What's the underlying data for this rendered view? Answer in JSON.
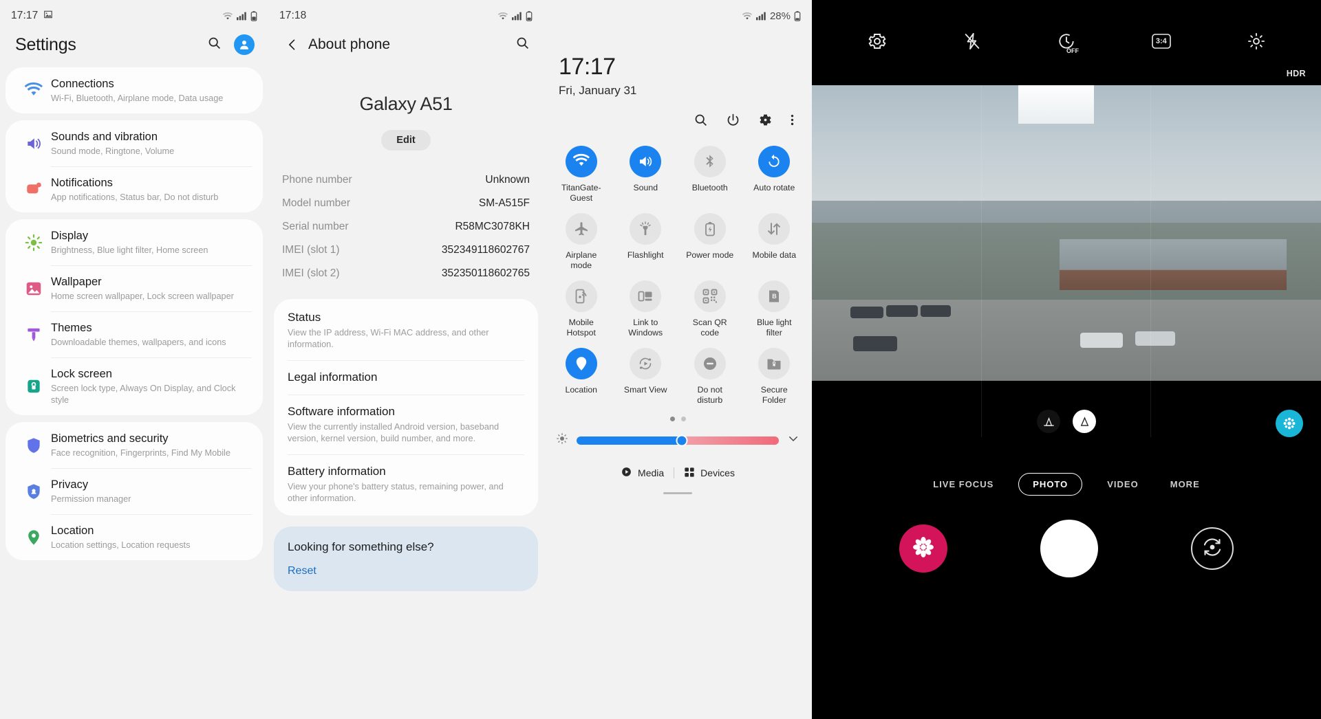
{
  "panel_settings": {
    "status": {
      "time": "17:17",
      "icons": [
        "image-icon",
        "wifi-icon",
        "signal-icon",
        "battery-icon"
      ]
    },
    "title": "Settings",
    "groups": [
      {
        "items": [
          {
            "name": "connections",
            "title": "Connections",
            "subtitle": "Wi-Fi, Bluetooth, Airplane mode, Data usage",
            "icon": "wifi-icon",
            "color": "#4a90e2"
          }
        ]
      },
      {
        "items": [
          {
            "name": "sounds-and-vibration",
            "title": "Sounds and vibration",
            "subtitle": "Sound mode, Ringtone, Volume",
            "icon": "speaker-icon",
            "color": "#6c63d8"
          },
          {
            "name": "notifications",
            "title": "Notifications",
            "subtitle": "App notifications, Status bar, Do not disturb",
            "icon": "notification-icon",
            "color": "#ef7066"
          }
        ]
      },
      {
        "items": [
          {
            "name": "display",
            "title": "Display",
            "subtitle": "Brightness, Blue light filter, Home screen",
            "icon": "brightness-icon",
            "color": "#7cc043"
          },
          {
            "name": "wallpaper",
            "title": "Wallpaper",
            "subtitle": "Home screen wallpaper, Lock screen wallpaper",
            "icon": "image-icon",
            "color": "#e05a86"
          },
          {
            "name": "themes",
            "title": "Themes",
            "subtitle": "Downloadable themes, wallpapers, and icons",
            "icon": "brush-icon",
            "color": "#a259d9"
          },
          {
            "name": "lock-screen",
            "title": "Lock screen",
            "subtitle": "Screen lock type, Always On Display, and Clock style",
            "icon": "lock-icon",
            "color": "#16a48a"
          }
        ]
      },
      {
        "items": [
          {
            "name": "biometrics-and-security",
            "title": "Biometrics and security",
            "subtitle": "Face recognition, Fingerprints, Find My Mobile",
            "icon": "shield-icon",
            "color": "#6272e8"
          },
          {
            "name": "privacy",
            "title": "Privacy",
            "subtitle": "Permission manager",
            "icon": "privacy-icon",
            "color": "#5b7fe0"
          },
          {
            "name": "location",
            "title": "Location",
            "subtitle": "Location settings, Location requests",
            "icon": "location-pin-icon",
            "color": "#3ba860"
          }
        ]
      }
    ]
  },
  "panel_about": {
    "status": {
      "time": "17:18"
    },
    "title": "About phone",
    "device_name": "Galaxy A51",
    "edit_label": "Edit",
    "info": [
      {
        "key": "Phone number",
        "value": "Unknown"
      },
      {
        "key": "Model number",
        "value": "SM-A515F"
      },
      {
        "key": "Serial number",
        "value": "R58MC3078KH"
      },
      {
        "key": "IMEI (slot 1)",
        "value": "352349118602767"
      },
      {
        "key": "IMEI (slot 2)",
        "value": "352350118602765"
      }
    ],
    "cards": [
      {
        "name": "status",
        "title": "Status",
        "subtitle": "View the IP address, Wi-Fi MAC address, and other information."
      },
      {
        "name": "legal-information",
        "title": "Legal information",
        "subtitle": ""
      },
      {
        "name": "software-information",
        "title": "Software information",
        "subtitle": "View the currently installed Android version, baseband version, kernel version, build number, and more."
      },
      {
        "name": "battery-information",
        "title": "Battery information",
        "subtitle": "View your phone's battery status, remaining power, and other information."
      }
    ],
    "looking_for": {
      "title": "Looking for something else?",
      "link": "Reset"
    }
  },
  "panel_quicksettings": {
    "status": {
      "battery_percent": "28%"
    },
    "clock": {
      "time": "17:17",
      "date": "Fri, January 31"
    },
    "toolbar": [
      "search-icon",
      "power-icon",
      "settings-gear-icon",
      "more-vertical-icon"
    ],
    "tiles": [
      {
        "name": "wifi",
        "label": "TitanGate-Guest",
        "icon": "wifi-icon",
        "on": true
      },
      {
        "name": "sound",
        "label": "Sound",
        "icon": "speaker-icon",
        "on": true
      },
      {
        "name": "bluetooth",
        "label": "Bluetooth",
        "icon": "bluetooth-icon",
        "on": false
      },
      {
        "name": "auto-rotate",
        "label": "Auto rotate",
        "icon": "rotate-icon",
        "on": true
      },
      {
        "name": "airplane-mode",
        "label": "Airplane mode",
        "icon": "airplane-icon",
        "on": false
      },
      {
        "name": "flashlight",
        "label": "Flashlight",
        "icon": "flashlight-icon",
        "on": false
      },
      {
        "name": "power-mode",
        "label": "Power mode",
        "icon": "battery-icon",
        "on": false
      },
      {
        "name": "mobile-data",
        "label": "Mobile data",
        "icon": "data-arrows-icon",
        "on": false
      },
      {
        "name": "mobile-hotspot",
        "label": "Mobile Hotspot",
        "icon": "hotspot-icon",
        "on": false
      },
      {
        "name": "link-to-windows",
        "label": "Link to Windows",
        "icon": "link-windows-icon",
        "on": false
      },
      {
        "name": "scan-qr-code",
        "label": "Scan QR code",
        "icon": "qr-code-icon",
        "on": false
      },
      {
        "name": "blue-light-filter",
        "label": "Blue light filter",
        "icon": "blue-light-icon",
        "on": false
      },
      {
        "name": "location",
        "label": "Location",
        "icon": "location-pin-icon",
        "on": true
      },
      {
        "name": "smart-view",
        "label": "Smart View",
        "icon": "smart-view-icon",
        "on": false
      },
      {
        "name": "do-not-disturb",
        "label": "Do not disturb",
        "icon": "minus-circle-icon",
        "on": false
      },
      {
        "name": "secure-folder",
        "label": "Secure Folder",
        "icon": "secure-folder-icon",
        "on": false
      }
    ],
    "page_dots": {
      "count": 2,
      "active": 0
    },
    "brightness": {
      "value_percent": 52,
      "icon": "brightness-icon",
      "expand_icon": "chevron-down-icon"
    },
    "footer": [
      {
        "name": "media",
        "label": "Media",
        "icon": "play-circle-icon"
      },
      {
        "name": "devices",
        "label": "Devices",
        "icon": "grid-icon"
      }
    ]
  },
  "panel_camera": {
    "top_icons": [
      {
        "name": "camera-settings",
        "icon": "gear-icon",
        "label": ""
      },
      {
        "name": "flash",
        "icon": "flash-off-icon",
        "label": ""
      },
      {
        "name": "timer",
        "icon": "timer-off-icon",
        "label": "OFF"
      },
      {
        "name": "aspect-ratio",
        "icon": "aspect-ratio-icon",
        "label": "3:4"
      },
      {
        "name": "effects",
        "icon": "sparkle-icon",
        "label": ""
      }
    ],
    "hdr_badge": "HDR",
    "zoom_buttons": [
      {
        "name": "ultrawide",
        "label": "",
        "selected": false
      },
      {
        "name": "wide",
        "label": "",
        "selected": true
      }
    ],
    "filter_button": {
      "name": "filter-button",
      "icon": "filter-icon"
    },
    "modes": [
      {
        "name": "live-focus",
        "label": "LIVE FOCUS",
        "active": false
      },
      {
        "name": "photo",
        "label": "PHOTO",
        "active": true
      },
      {
        "name": "video",
        "label": "VIDEO",
        "active": false
      },
      {
        "name": "more",
        "label": "MORE",
        "active": false
      }
    ],
    "controls": [
      {
        "name": "gallery-button",
        "icon": "flower-icon"
      },
      {
        "name": "shutter-button",
        "icon": "shutter-icon"
      },
      {
        "name": "switch-camera-button",
        "icon": "camera-switch-icon"
      }
    ]
  }
}
